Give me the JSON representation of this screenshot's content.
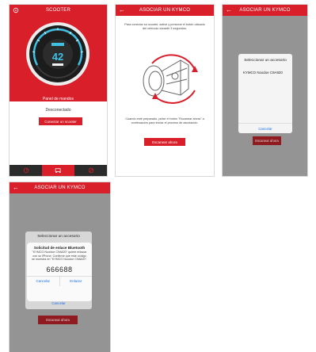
{
  "screen1": {
    "title": "SCOOTER",
    "speed": "42",
    "panel_title": "Panel de mandos",
    "status": "Desconectado",
    "connect_button": "Conectar un scooter"
  },
  "screen2": {
    "title": "ASOCIAR UN KYMCO",
    "instruction_top": "Para conectar su scooter, active y presione el botón ubicado del vehículo durante 3 segundos.",
    "instruction_bottom": "Cuando esté preparado, pulse el botón \"Escanear ahora\" a continuación para iniciar el proceso de asociación.",
    "scan_button": "Escanear ahora"
  },
  "screen3": {
    "title": "ASOCIAR UN KYMCO",
    "sheet_title": "Seleccionar un accesorio",
    "device": "KYMCO Noodoe C9A820",
    "cancel": "Cancelar",
    "scan_button": "Escanear ahora"
  },
  "screen4": {
    "title": "ASOCIAR UN KYMCO",
    "sheet_title": "Seleccionar un accesorio",
    "alert_title": "Solicitud de enlace Bluetooth",
    "alert_message": "\"KYMCO Noodoe C9A820\" quiere enlazar con su iPhone. Confirme que este código se muestra en \"KYMCO Noodoe C9A820\".",
    "code": "666688",
    "cancel": "Cancelar",
    "pair": "Enlazar",
    "sheet_cancel": "Cancelar",
    "scan_button": "Escanear ahora"
  }
}
